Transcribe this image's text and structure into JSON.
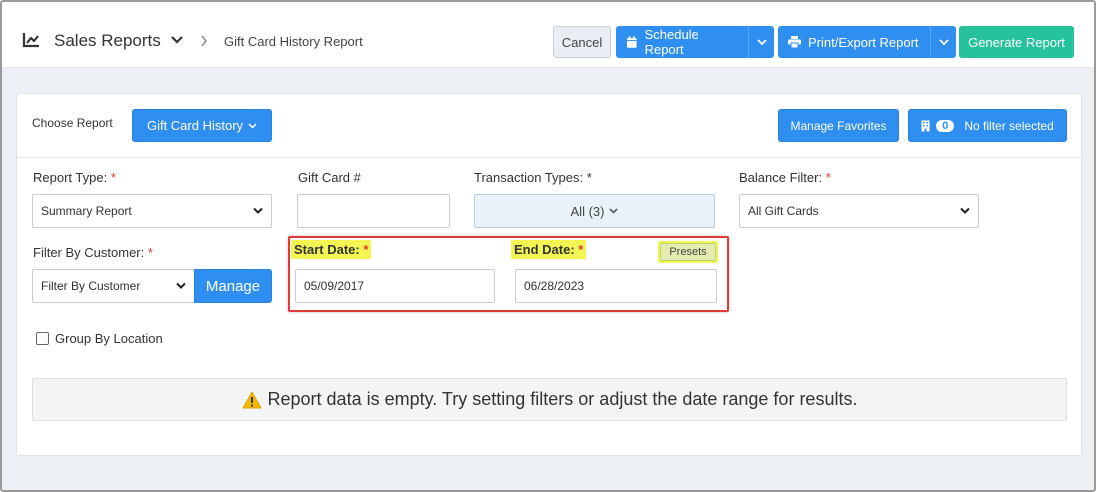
{
  "header": {
    "title": "Sales Reports",
    "current": "Gift Card History Report",
    "buttons": {
      "cancel": "Cancel",
      "schedule": "Schedule Report",
      "print_export": "Print/Export Report",
      "generate": "Generate Report"
    }
  },
  "toolbar": {
    "choose_report_label": "Choose Report",
    "report_selected": "Gift Card History",
    "manage_favorites": "Manage Favorites",
    "filter_count": "0",
    "filter_status": "No filter selected"
  },
  "filters": {
    "report_type": {
      "label": "Report Type:",
      "required": "*",
      "value": "Summary Report"
    },
    "gift_card": {
      "label": "Gift Card #",
      "value": ""
    },
    "transaction_types": {
      "label": "Transaction Types:",
      "required": "*",
      "value": "All (3)"
    },
    "balance_filter": {
      "label": "Balance Filter:",
      "required": "*",
      "value": "All Gift Cards"
    },
    "customer": {
      "label": "Filter By Customer:",
      "required": "*",
      "value": "Filter By Customer",
      "manage": "Manage"
    },
    "start_date": {
      "label": "Start Date:",
      "required": "*",
      "value": "05/09/2017"
    },
    "end_date": {
      "label": "End Date:",
      "required": "*",
      "value": "06/28/2023"
    },
    "presets": "Presets",
    "group_by_location": "Group By Location"
  },
  "alert": {
    "message": "Report data is empty. Try setting filters or adjust the date range for results."
  },
  "colors": {
    "primary": "#2f8ff0",
    "success": "#25c29b",
    "highlight": "#f3f552",
    "annotation": "#e03a3a",
    "warning": "#f5b800"
  }
}
